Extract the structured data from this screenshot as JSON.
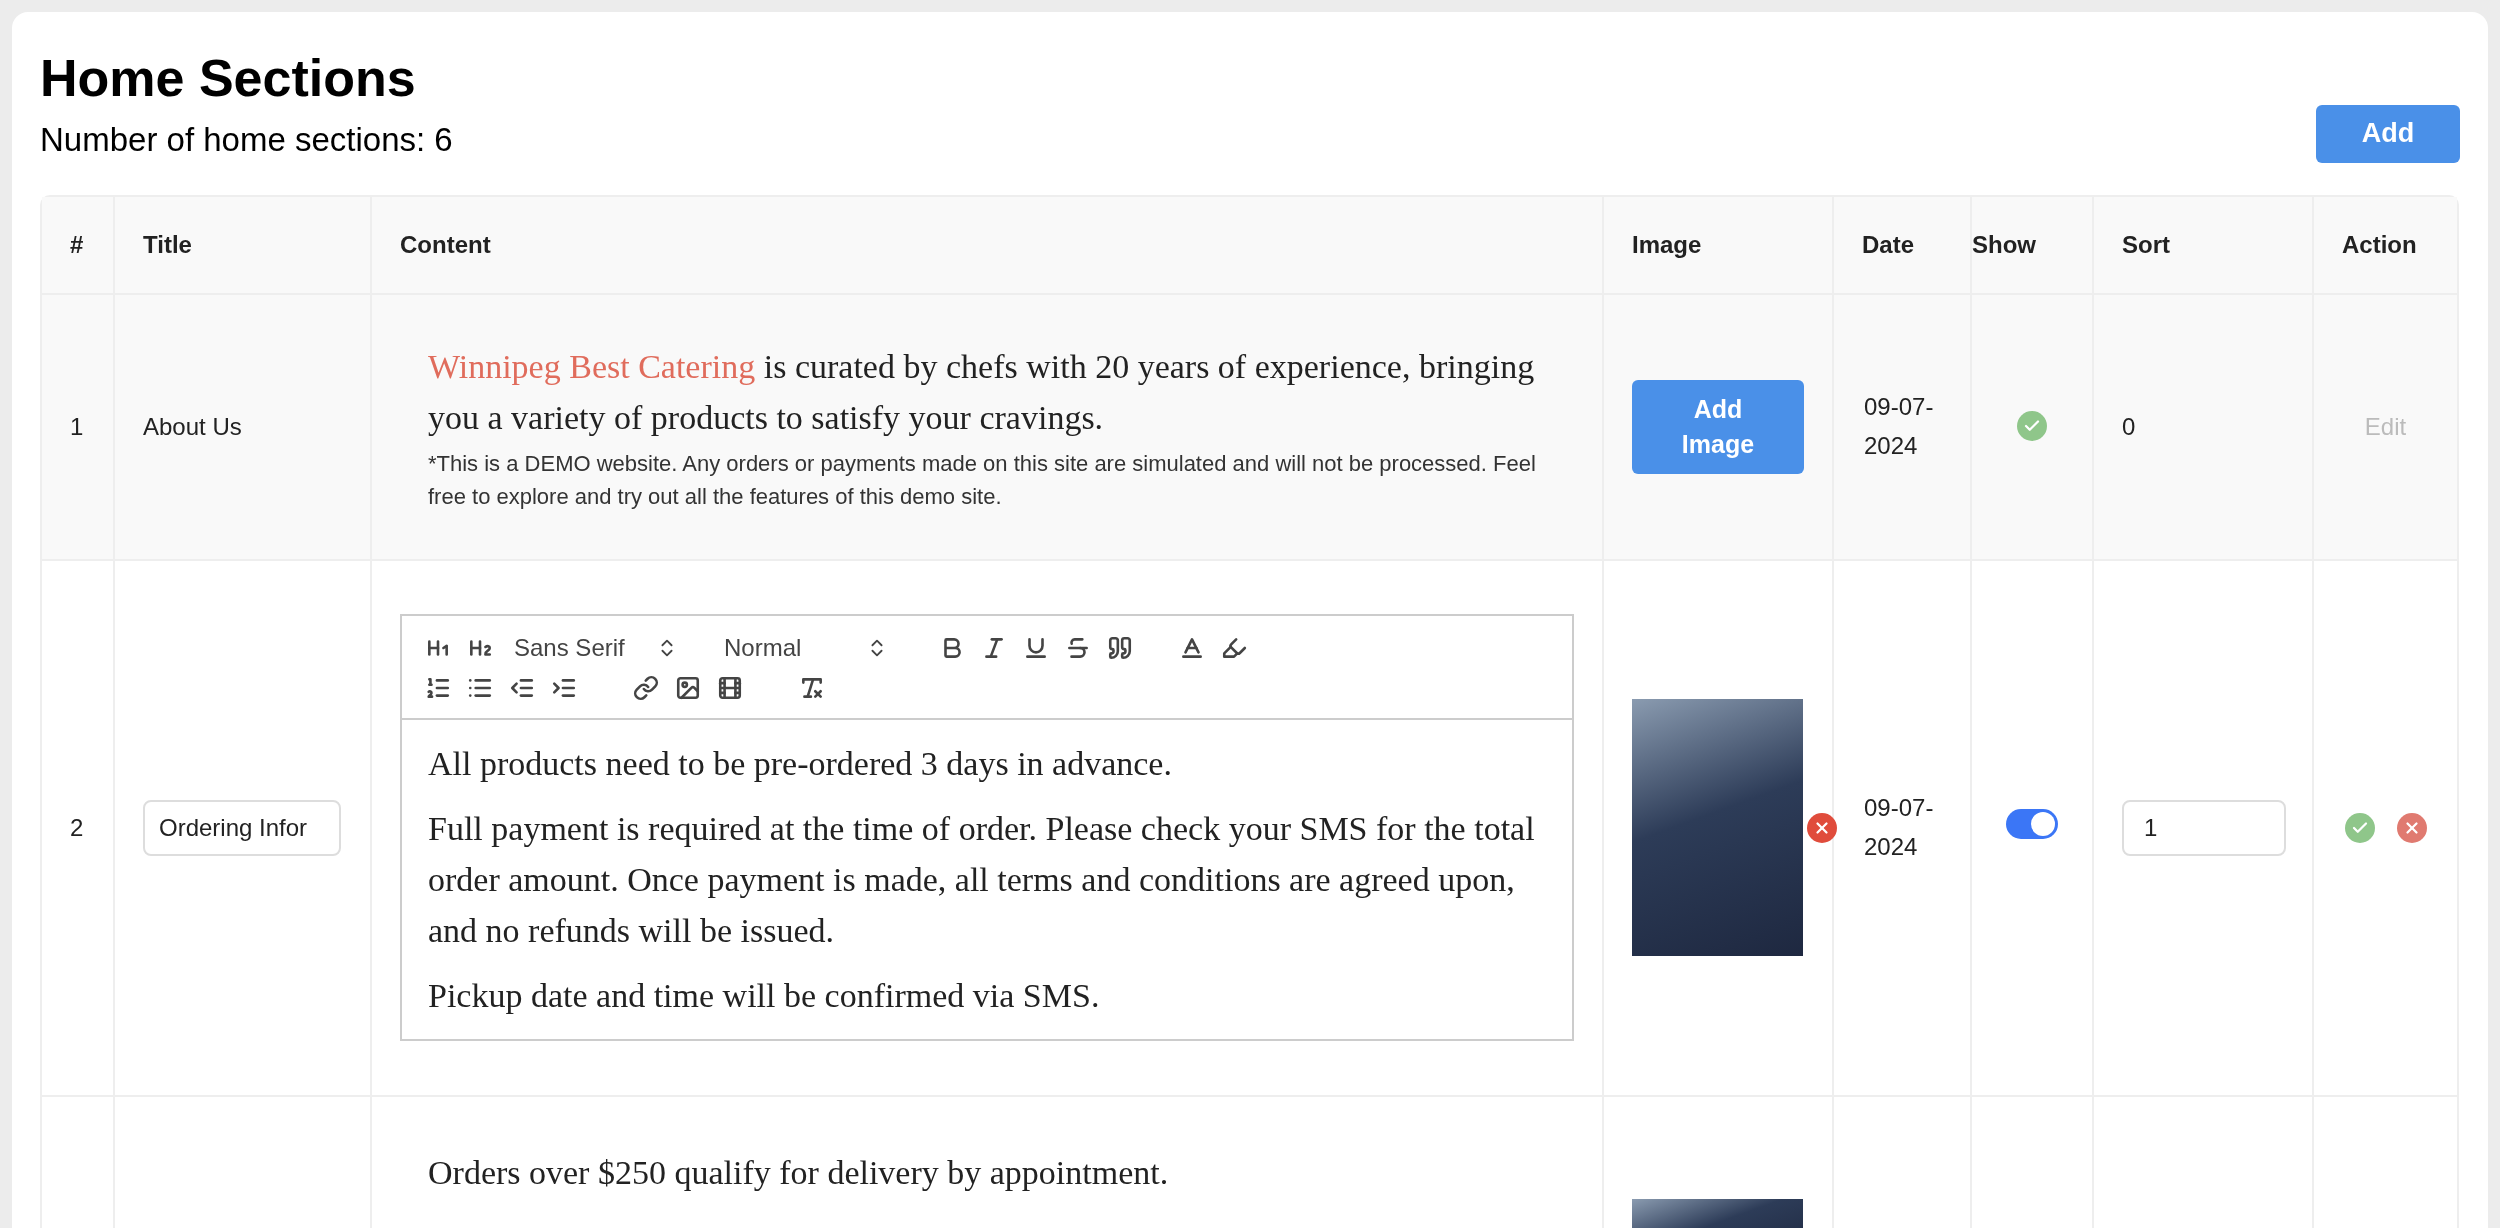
{
  "heading": {
    "title": "Home Sections",
    "count_label": "Number of home sections: 6",
    "add_button": "Add"
  },
  "columns": [
    "#",
    "Title",
    "Content",
    "Image",
    "Date",
    "Show",
    "Sort",
    "Action"
  ],
  "rows": [
    {
      "kind": "view",
      "index": "1",
      "title": "About Us",
      "content": {
        "paragraphs": [
          [
            {
              "text": "Winnipeg Best Catering",
              "color": "#e06c5c"
            },
            {
              "text": " is curated by chefs with 20 years of experience, bringing you a variety of products to satisfy your cravings."
            }
          ]
        ],
        "note": "*This is a DEMO website. Any orders or payments made on this site are simulated and will not be processed. Feel free to explore and try out all the features of this demo site."
      },
      "image": {
        "kind": "button",
        "label": "Add Image"
      },
      "date": "09-07-2024",
      "show": true,
      "sort": "0",
      "action": {
        "label": "Edit",
        "disabled": true
      }
    },
    {
      "kind": "edit",
      "index": "2",
      "title": "Ordering Infor",
      "content": {
        "font": "Sans Serif",
        "size": "Normal",
        "paragraphs": [
          [
            {
              "text": "All products need to be pre-ordered 3 days in advance."
            }
          ],
          [
            {
              "text": "Full payment is required at the time of order. Please check your SMS for the total order amount. Once payment is made, all terms and conditions are agreed upon, and no refunds will be issued."
            }
          ],
          [
            {
              "text": "Pickup date and time will be confirmed via SMS."
            }
          ]
        ]
      },
      "image": {
        "kind": "photo"
      },
      "date": "09-07-2024",
      "show": true,
      "sort": "1"
    },
    {
      "kind": "partial",
      "content": {
        "paragraphs": [
          [
            {
              "text": "Orders over $250 qualify for delivery by appointment."
            }
          ]
        ]
      },
      "image": {
        "kind": "photo"
      }
    }
  ]
}
